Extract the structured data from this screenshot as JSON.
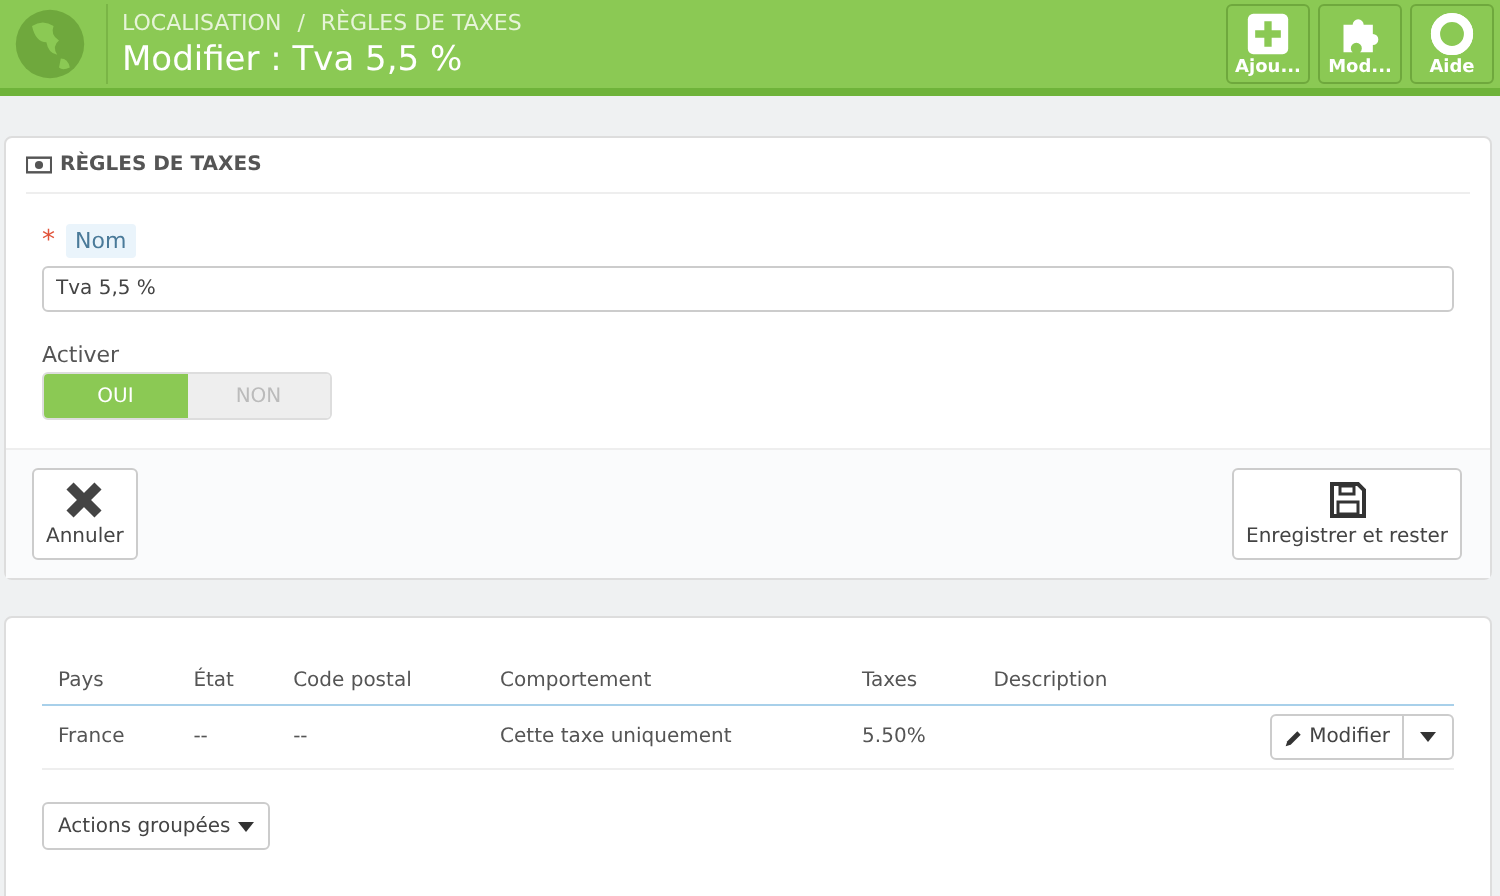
{
  "header": {
    "breadcrumb": [
      "LOCALISATION",
      "RÈGLES DE TAXES"
    ],
    "separator": "/",
    "title": "Modifier : Tva 5,5 %",
    "toolbar": [
      {
        "kind": "add",
        "label": "Ajou..."
      },
      {
        "kind": "modules",
        "label": "Mod..."
      },
      {
        "kind": "help",
        "label": "Aide"
      }
    ]
  },
  "form": {
    "heading": "RÈGLES DE TAXES",
    "name_field": {
      "required_mark": "*",
      "label": "Nom",
      "value": "Tva 5,5 %"
    },
    "activate": {
      "label": "Activer",
      "options": [
        {
          "label": "OUI",
          "selected": true
        },
        {
          "label": "NON",
          "selected": false
        }
      ]
    },
    "footer": {
      "cancel": "Annuler",
      "save": "Enregistrer et rester"
    }
  },
  "table": {
    "columns": [
      "Pays",
      "État",
      "Code postal",
      "Comportement",
      "Taxes",
      "Description"
    ],
    "rows": [
      {
        "cells": [
          "France",
          "--",
          "--",
          "Cette taxe uniquement",
          "5.50%",
          ""
        ],
        "action": "Modifier"
      }
    ],
    "bulk_actions": "Actions groupées"
  }
}
